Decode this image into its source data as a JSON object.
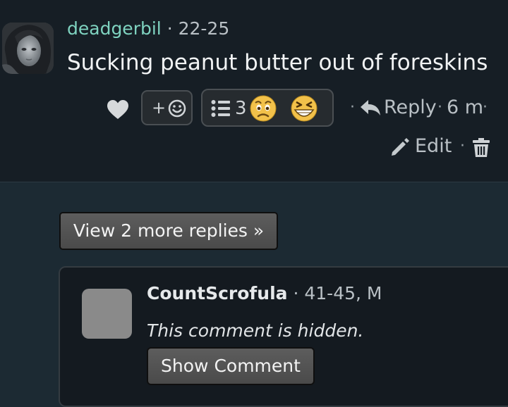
{
  "comment": {
    "username": "deadgerbil",
    "separator": "·",
    "age_range": "22-25",
    "text": "Sucking peanut butter out of foreskins"
  },
  "actions": {
    "like_icon": "heart-icon",
    "add_reaction_plus": "+",
    "add_reaction_icon": "smiley-icon",
    "reactions_list_icon": "list-icon",
    "reaction_count": "3",
    "reaction_emojis": [
      "worried-face-emoji",
      "grinning-squint-emoji"
    ],
    "dot": "·",
    "reply_label": "Reply",
    "time_ago": "6 m",
    "edit_label": "Edit",
    "delete_icon": "trash-icon"
  },
  "thread": {
    "view_more_label": "View 2 more replies »"
  },
  "hidden_comment": {
    "username": "CountScrofula",
    "details": "· 41-45, M",
    "notice": "This comment is hidden.",
    "show_button_label": "Show Comment"
  },
  "colors": {
    "username_accent": "#7fd3c0",
    "background": "#1c2a33",
    "card_background": "#161e25"
  }
}
